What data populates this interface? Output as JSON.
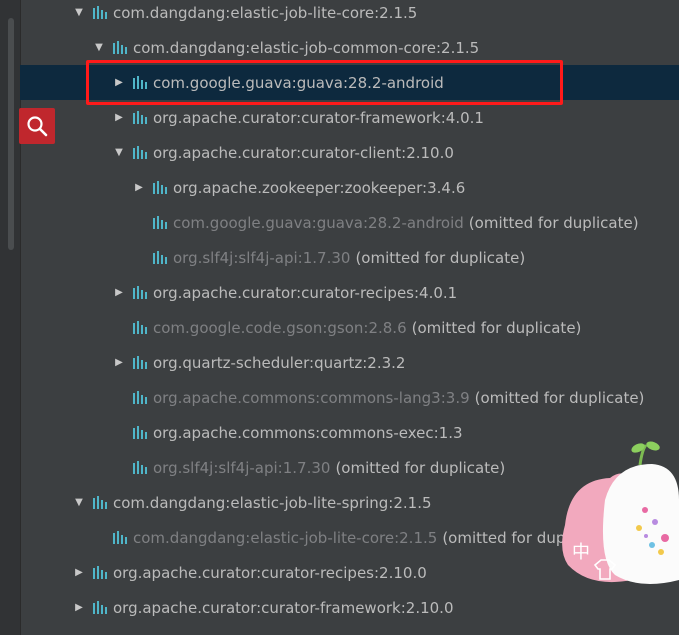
{
  "tree": {
    "rows": [
      {
        "name": "com.dangdang:elastic-job-lite-core:2.1.5",
        "suffix": "",
        "expander": "expanded",
        "dim": false
      },
      {
        "name": "com.dangdang:elastic-job-common-core:2.1.5",
        "suffix": "",
        "expander": "expanded",
        "dim": false
      },
      {
        "name": "com.google.guava:guava:28.2-android",
        "suffix": "",
        "expander": "collapsed",
        "dim": false,
        "selected": true
      },
      {
        "name": "org.apache.curator:curator-framework:4.0.1",
        "suffix": "",
        "expander": "collapsed",
        "dim": false
      },
      {
        "name": "org.apache.curator:curator-client:2.10.0",
        "suffix": "",
        "expander": "expanded",
        "dim": false
      },
      {
        "name": "org.apache.zookeeper:zookeeper:3.4.6",
        "suffix": "",
        "expander": "collapsed",
        "dim": false
      },
      {
        "name": "com.google.guava:guava:28.2-android",
        "suffix": "(omitted for duplicate)",
        "expander": "none",
        "dim": true
      },
      {
        "name": "org.slf4j:slf4j-api:1.7.30",
        "suffix": "(omitted for duplicate)",
        "expander": "none",
        "dim": true
      },
      {
        "name": "org.apache.curator:curator-recipes:4.0.1",
        "suffix": "",
        "expander": "collapsed",
        "dim": false
      },
      {
        "name": "com.google.code.gson:gson:2.8.6",
        "suffix": "(omitted for duplicate)",
        "expander": "none",
        "dim": true
      },
      {
        "name": "org.quartz-scheduler:quartz:2.3.2",
        "suffix": "",
        "expander": "collapsed",
        "dim": false
      },
      {
        "name": "org.apache.commons:commons-lang3:3.9",
        "suffix": "(omitted for duplicate)",
        "expander": "none",
        "dim": true
      },
      {
        "name": "org.apache.commons:commons-exec:1.3",
        "suffix": "",
        "expander": "none",
        "dim": false
      },
      {
        "name": "org.slf4j:slf4j-api:1.7.30",
        "suffix": "(omitted for duplicate)",
        "expander": "none",
        "dim": true
      },
      {
        "name": "com.dangdang:elastic-job-lite-spring:2.1.5",
        "suffix": "",
        "expander": "expanded",
        "dim": false
      },
      {
        "name": "com.dangdang:elastic-job-lite-core:2.1.5",
        "suffix": "(omitted for duplicate)",
        "expander": "none",
        "dim": true
      },
      {
        "name": "org.apache.curator:curator-recipes:2.10.0",
        "suffix": "",
        "expander": "collapsed",
        "dim": false
      },
      {
        "name": "org.apache.curator:curator-framework:2.10.0",
        "suffix": "",
        "expander": "collapsed",
        "dim": false
      }
    ]
  },
  "sticker": {
    "label": "中"
  },
  "colors": {
    "background": "#3c3f41",
    "selection": "#0d293e",
    "highlight_border": "#ff1a1a",
    "search_button": "#c0272d",
    "lib_icon": "#4fb6c9"
  },
  "icons": {
    "library": "maven-library-icon",
    "search": "search-icon",
    "expand": "triangle-down-icon",
    "collapse": "triangle-right-icon"
  }
}
